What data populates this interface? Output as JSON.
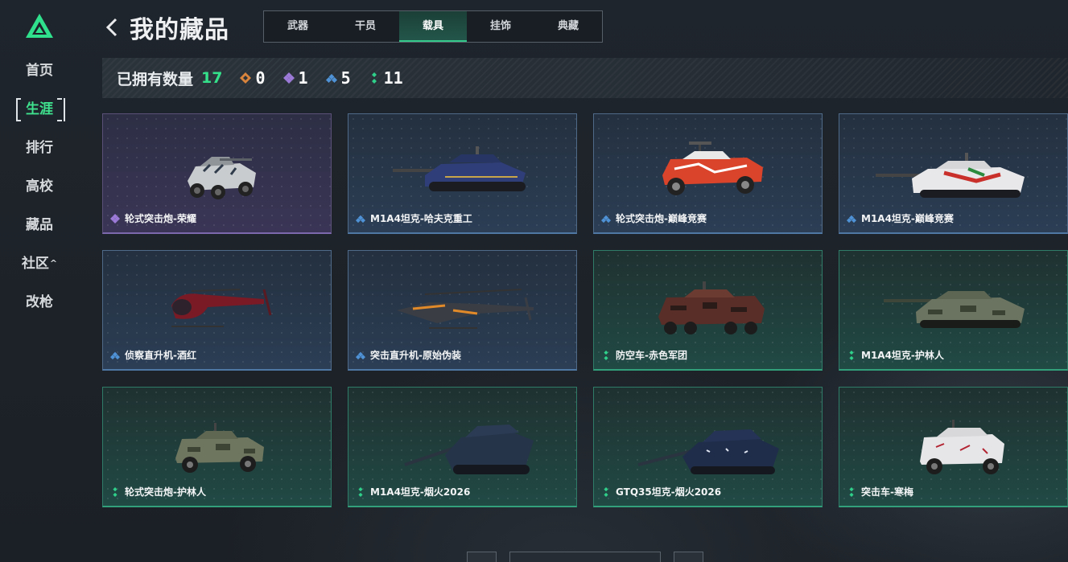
{
  "sidebar": {
    "items": [
      {
        "label": "首页"
      },
      {
        "label": "生涯",
        "active": true
      },
      {
        "label": "排行"
      },
      {
        "label": "高校"
      },
      {
        "label": "藏品"
      },
      {
        "label": "社区",
        "caret": "^"
      },
      {
        "label": "改枪"
      }
    ]
  },
  "header": {
    "title": "我的藏品",
    "tabs": [
      {
        "label": "武器"
      },
      {
        "label": "干员"
      },
      {
        "label": "载具",
        "active": true
      },
      {
        "label": "挂饰"
      },
      {
        "label": "典藏"
      }
    ]
  },
  "summary": {
    "label": "已拥有数量",
    "count": "17",
    "rarities": [
      {
        "icon": "orange-diamond-icon",
        "value": "0",
        "color": "#d8843c"
      },
      {
        "icon": "purple-diamond-icon",
        "value": "1",
        "color": "#9b7ad8"
      },
      {
        "icon": "blue-diamond-icon",
        "value": "5",
        "color": "#4f93d6"
      },
      {
        "icon": "green-diamond-icon",
        "value": "11",
        "color": "#2fd08a"
      }
    ]
  },
  "cards": [
    {
      "name": "轮式突击炮-荣耀",
      "rarity": "purple"
    },
    {
      "name": "M1A4坦克-哈夫克重工",
      "rarity": "blue"
    },
    {
      "name": "轮式突击炮-巅峰竞赛",
      "rarity": "blue"
    },
    {
      "name": "M1A4坦克-巅峰竞赛",
      "rarity": "blue"
    },
    {
      "name": "侦察直升机-酒红",
      "rarity": "blue"
    },
    {
      "name": "突击直升机-原始伪装",
      "rarity": "blue"
    },
    {
      "name": "防空车-赤色军团",
      "rarity": "green"
    },
    {
      "name": "M1A4坦克-护林人",
      "rarity": "green"
    },
    {
      "name": "轮式突击炮-护林人",
      "rarity": "green"
    },
    {
      "name": "M1A4坦克-烟火2026",
      "rarity": "green"
    },
    {
      "name": "GTQ35坦克-烟火2026",
      "rarity": "green"
    },
    {
      "name": "突击车-寒梅",
      "rarity": "green"
    }
  ],
  "colors": {
    "accent": "#35e08a",
    "purple": "#9b7ad8",
    "blue": "#4f93d6",
    "green": "#2fd08a"
  }
}
